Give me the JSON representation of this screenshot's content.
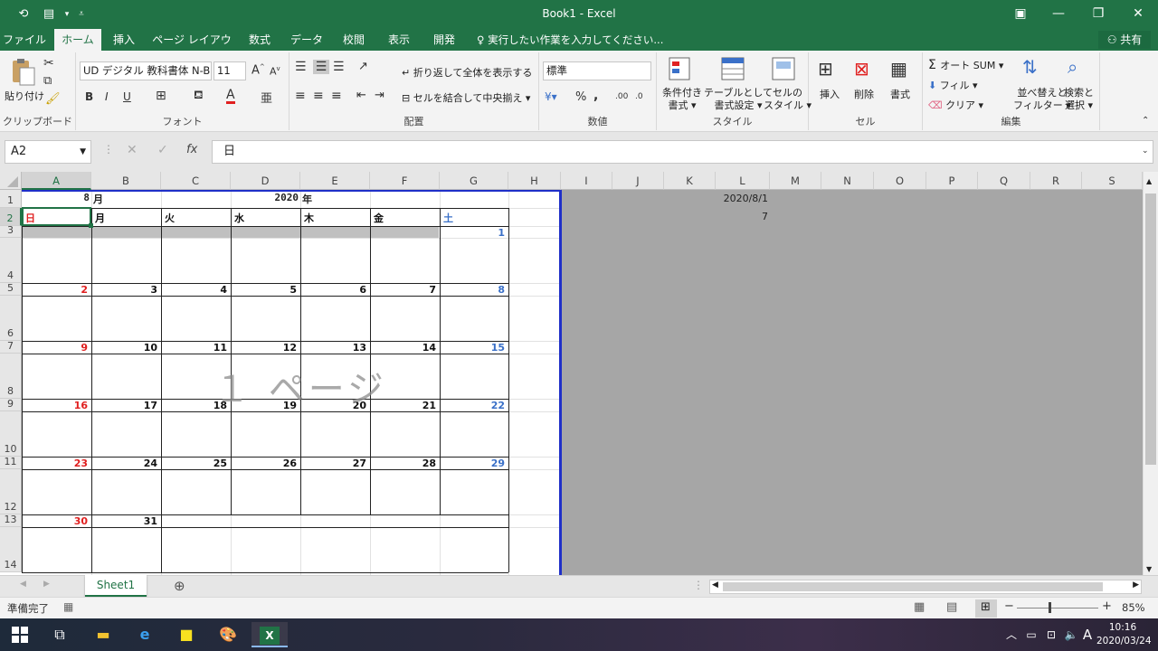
{
  "titlebar": {
    "title": "Book1 - Excel"
  },
  "tabs": [
    "ファイル",
    "ホーム",
    "挿入",
    "ページ レイアウト",
    "数式",
    "データ",
    "校閲",
    "表示",
    "開発"
  ],
  "tell_me": "実行したい作業を入力してください...",
  "share": "共有",
  "ribbon": {
    "clipboard": {
      "paste": "貼り付け",
      "label": "クリップボード"
    },
    "font": {
      "name": "UD デジタル 教科書体 N-B",
      "size": "11",
      "bold": "B",
      "italic": "I",
      "underline": "U",
      "label": "フォント"
    },
    "align": {
      "wrap": "折り返して全体を表示する",
      "merge": "セルを結合して中央揃え",
      "label": "配置"
    },
    "number": {
      "format": "標準",
      "percent": "%",
      "comma": ",",
      "label": "数値"
    },
    "styles": {
      "cond1": "条件付き",
      "cond2": "書式",
      "table1": "テーブルとして",
      "table2": "書式設定",
      "cell1": "セルの",
      "cell2": "スタイル",
      "label": "スタイル"
    },
    "cells": {
      "insert": "挿入",
      "delete": "削除",
      "format": "書式",
      "label": "セル"
    },
    "editing": {
      "autosum": "オート SUM",
      "fill": "フィル",
      "clear": "クリア",
      "sort1": "並べ替えと",
      "sort2": "フィルター",
      "find1": "検索と",
      "find2": "選択",
      "label": "編集"
    }
  },
  "namebox": "A2",
  "formula": "日",
  "columns": [
    "A",
    "B",
    "C",
    "D",
    "E",
    "F",
    "G",
    "H",
    "I",
    "J",
    "K",
    "L",
    "M",
    "N",
    "O",
    "P",
    "Q",
    "R",
    "S"
  ],
  "rows": [
    "1",
    "2",
    "3",
    "4",
    "5",
    "6",
    "7",
    "8",
    "9",
    "10",
    "11",
    "12",
    "13",
    "14"
  ],
  "calendar": {
    "month": "8",
    "month_unit": "月",
    "year": "2020",
    "year_unit": "年",
    "weekdays": [
      "日",
      "月",
      "火",
      "水",
      "木",
      "金",
      "土"
    ],
    "weeks": [
      [
        "",
        "",
        "",
        "",
        "",
        "",
        "1"
      ],
      [
        "2",
        "3",
        "4",
        "5",
        "6",
        "7",
        "8"
      ],
      [
        "9",
        "10",
        "11",
        "12",
        "13",
        "14",
        "15"
      ],
      [
        "16",
        "17",
        "18",
        "19",
        "20",
        "21",
        "22"
      ],
      [
        "23",
        "24",
        "25",
        "26",
        "27",
        "28",
        "29"
      ],
      [
        "30",
        "31",
        "",
        "",
        "",
        "",
        ""
      ]
    ]
  },
  "cells_outside": {
    "L1": "2020/8/1",
    "L2": "7"
  },
  "watermark": "１ ページ",
  "sheet_tab": "Sheet1",
  "status": {
    "ready": "準備完了",
    "zoom": "85%"
  },
  "taskbar": {
    "time": "10:16",
    "date": "2020/03/24",
    "ime": "A"
  },
  "colors": {
    "excel_green": "#217346",
    "sunday": "#e02020",
    "saturday": "#3a70c8",
    "page_border": "#1f2fc8"
  }
}
